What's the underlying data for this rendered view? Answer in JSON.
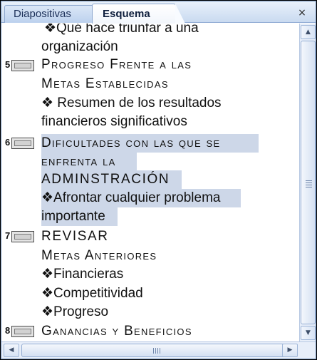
{
  "tabs": {
    "slides_label": "Diapositivas",
    "outline_label": "Esquema",
    "close_glyph": "×",
    "active": "Esquema"
  },
  "outline": {
    "top_partial": {
      "line1": "❖Qué hace triunfar a una",
      "line2": "organización"
    },
    "slides": [
      {
        "number": "5",
        "title_lines": [
          "Progreso Frente a las",
          "Metas Establecidas"
        ],
        "bullets": [
          "❖ Resumen de los resultados",
          "financieros significativos"
        ]
      },
      {
        "number": "6",
        "title_lines": [
          "Dificultades con las que se",
          "enfrenta la",
          "ADMINSTRACIÓN"
        ],
        "bullets": [
          "❖Afrontar cualquier problema",
          "importante"
        ],
        "selected": true
      },
      {
        "number": "7",
        "title_lines": [
          "REVISAR",
          "Metas Anteriores"
        ],
        "bullets": [
          "❖Financieras",
          "❖Competitividad",
          "❖Progreso"
        ]
      },
      {
        "number": "8",
        "title_lines": [
          "Ganancias y Beneficios"
        ],
        "bullets": []
      }
    ]
  },
  "scrollbar": {
    "up_glyph": "▲",
    "down_glyph": "▼",
    "left_glyph": "◀",
    "right_glyph": "▶"
  },
  "colors": {
    "selection": "#cdd7e8",
    "tab_bar": "#c9daf0",
    "border": "#6d8bb5"
  }
}
